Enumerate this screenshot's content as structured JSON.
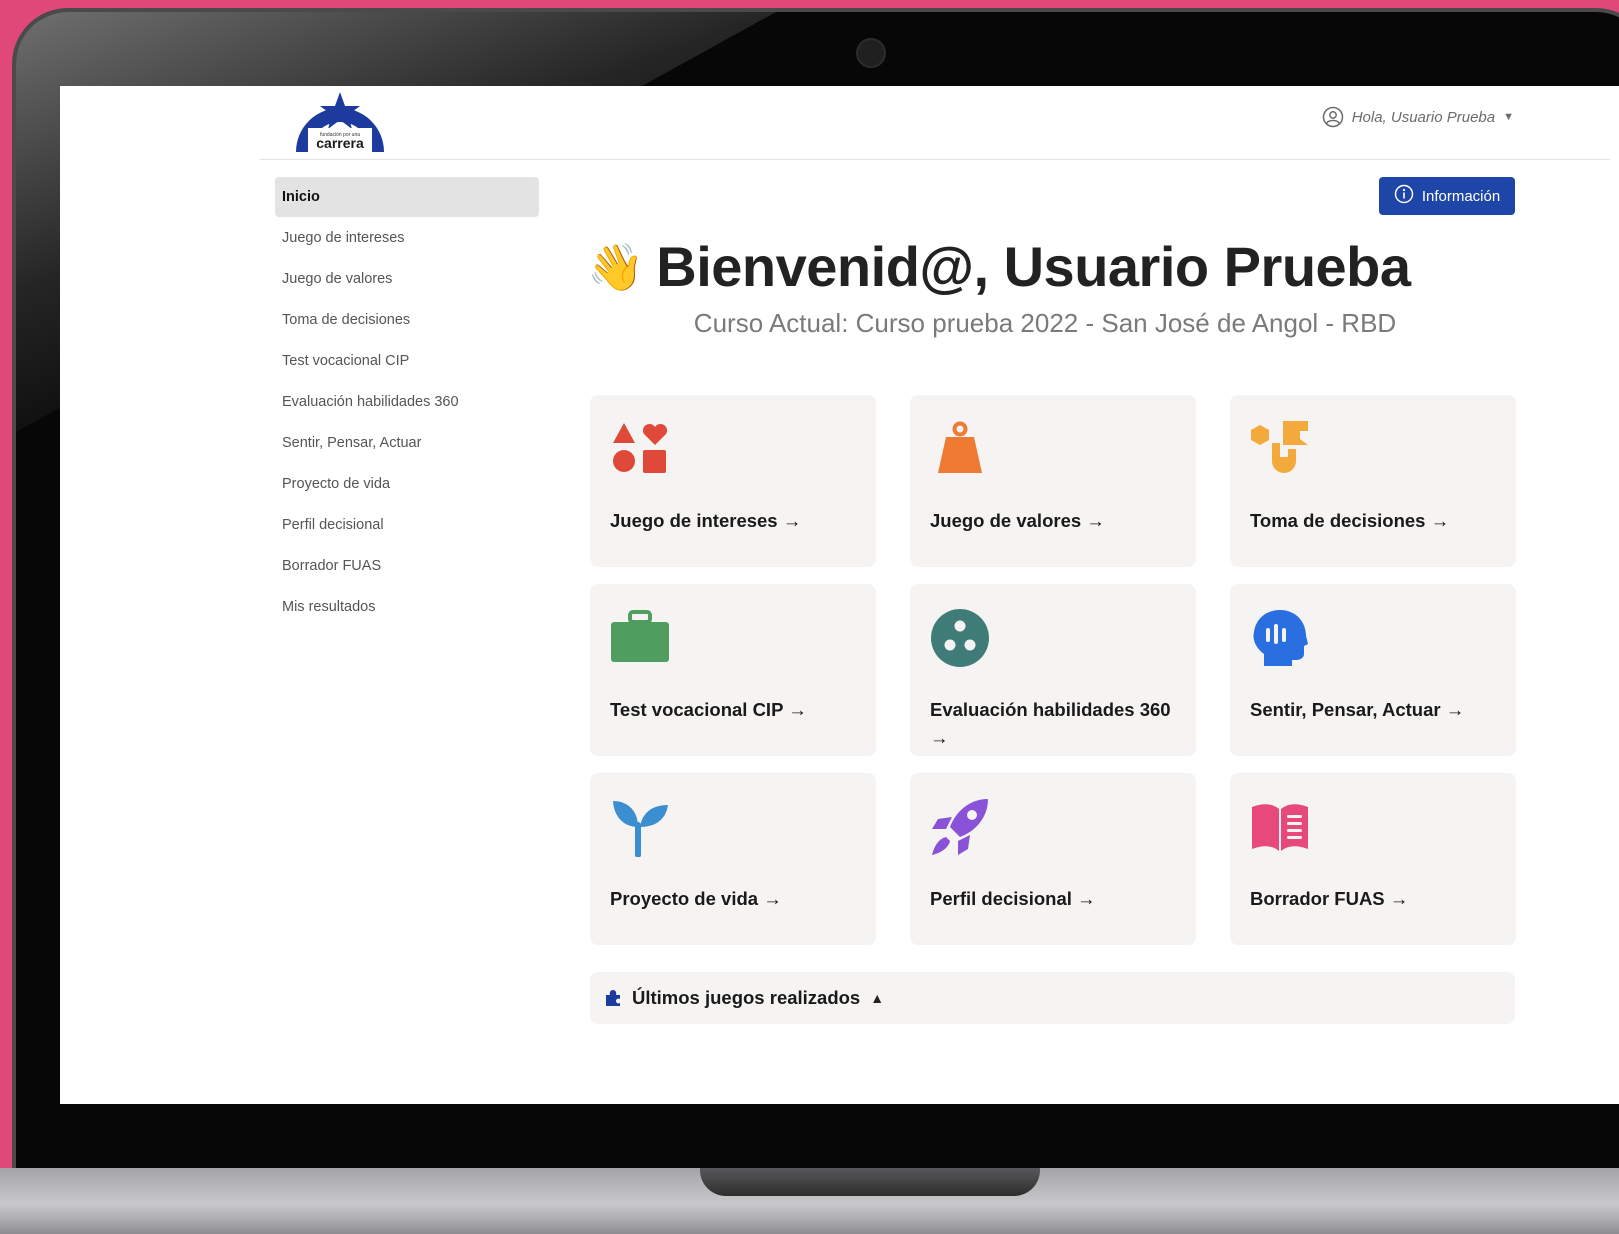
{
  "header": {
    "logo_text": "carrera",
    "logo_subtext": "fundación por una",
    "greeting": "Hola, Usuario Prueba"
  },
  "info_button": {
    "label": "Información"
  },
  "sidebar": {
    "items": [
      {
        "label": "Inicio",
        "active": true
      },
      {
        "label": "Juego de intereses"
      },
      {
        "label": "Juego de valores"
      },
      {
        "label": "Toma de decisiones"
      },
      {
        "label": "Test vocacional CIP"
      },
      {
        "label": "Evaluación habilidades 360"
      },
      {
        "label": "Sentir, Pensar, Actuar"
      },
      {
        "label": "Proyecto de vida"
      },
      {
        "label": "Perfil decisional"
      },
      {
        "label": "Borrador FUAS"
      },
      {
        "label": "Mis resultados"
      }
    ]
  },
  "main": {
    "wave_emoji": "👋",
    "title": "Bienvenid@, Usuario Prueba",
    "subtitle": "Curso Actual: Curso prueba 2022 - San José de Angol - RBD",
    "cards": [
      {
        "label": "Juego de intereses →",
        "icon": "shapes-icon",
        "color": "#e0483a"
      },
      {
        "label": "Juego de valores →",
        "icon": "weight-icon",
        "color": "#ee7a33"
      },
      {
        "label": "Toma de decisiones →",
        "icon": "decision-shapes-icon",
        "color": "#f3a93b"
      },
      {
        "label": "Test vocacional CIP →",
        "icon": "briefcase-icon",
        "color": "#4f9d5f"
      },
      {
        "label": "Evaluación habilidades 360 →",
        "icon": "circle-dots-icon",
        "color": "#3f7c78"
      },
      {
        "label": "Sentir, Pensar, Actuar →",
        "icon": "head-icon",
        "color": "#2a6fe0"
      },
      {
        "label": "Proyecto de vida →",
        "icon": "sprout-icon",
        "color": "#3b8fd1"
      },
      {
        "label": "Perfil decisional →",
        "icon": "rocket-icon",
        "color": "#8a52d6"
      },
      {
        "label": "Borrador FUAS →",
        "icon": "book-icon",
        "color": "#e6497a"
      }
    ],
    "recent": {
      "title": "Últimos juegos realizados",
      "icon": "puzzle-icon",
      "state_icon": "triangle-up-icon"
    }
  },
  "colors": {
    "background": "#e0487a",
    "primary_button": "#1d46a8",
    "card_bg": "#f5f4f2",
    "active_sidebar": "#e3e3e3"
  }
}
